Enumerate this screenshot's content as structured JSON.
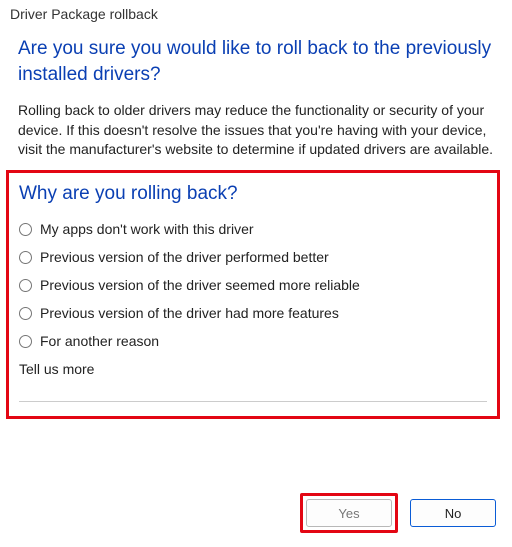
{
  "window": {
    "title": "Driver Package rollback"
  },
  "heading": "Are you sure you would like to roll back to the previously installed drivers?",
  "body": "Rolling back to older drivers may reduce the functionality or security of your device. If this doesn't resolve the issues that you're having with your device, visit the manufacturer's website to determine if updated drivers are available.",
  "section": {
    "title": "Why are you rolling back?",
    "options": [
      "My apps don't work with this driver",
      "Previous version of the driver performed better",
      "Previous version of the driver seemed more reliable",
      "Previous version of the driver had more features",
      "For another reason"
    ],
    "tell_more_label": "Tell us more",
    "tell_more_value": ""
  },
  "buttons": {
    "yes": "Yes",
    "no": "No"
  }
}
